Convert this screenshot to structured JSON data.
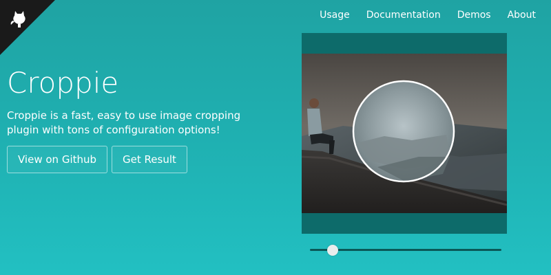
{
  "nav": {
    "items": [
      {
        "label": "Usage"
      },
      {
        "label": "Documentation"
      },
      {
        "label": "Demos"
      },
      {
        "label": "About"
      }
    ]
  },
  "hero": {
    "title": "Croppie",
    "description": "Croppie is a fast, easy to use image cropping plugin with tons of configuration options!",
    "buttons": {
      "github": "View on Github",
      "result": "Get Result"
    }
  },
  "corner": {
    "icon": "github-octocat-icon"
  },
  "slider": {
    "zoom_fraction": 0.12
  },
  "colors": {
    "bg_top": "#1fa3a3",
    "bg_bottom": "#22c0c2",
    "cropper_frame": "#0d6b6a",
    "corner": "#1a1a1a",
    "slider_track": "#0a5857",
    "slider_thumb": "#e9eded"
  }
}
